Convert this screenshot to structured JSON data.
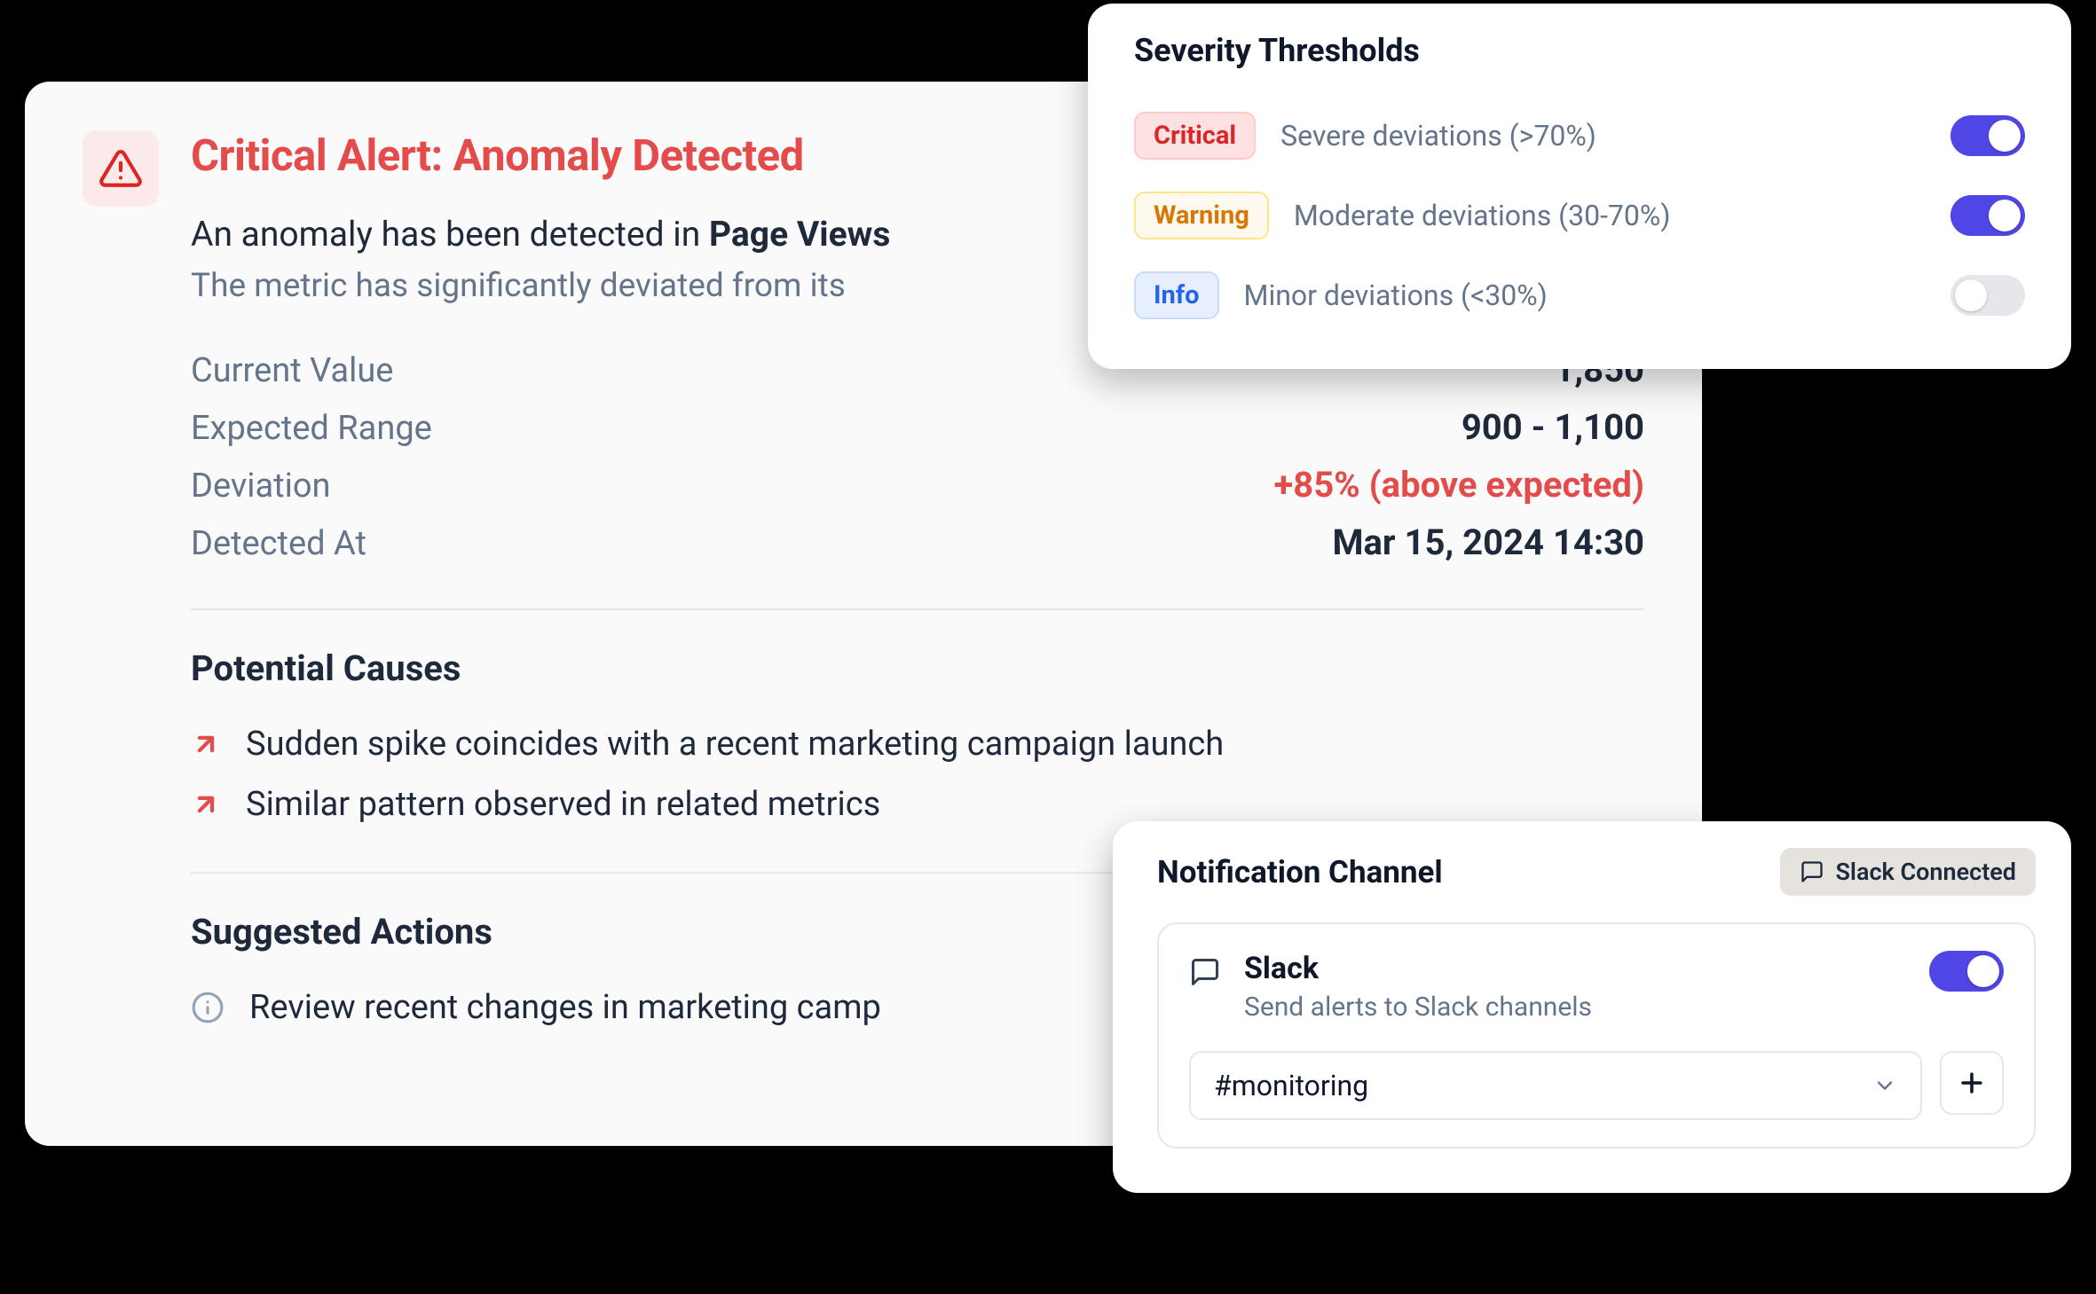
{
  "alert": {
    "title": "Critical Alert: Anomaly Detected",
    "description_prefix": "An anomaly has been detected in ",
    "metric_name": "Page Views",
    "sub": "The metric has significantly deviated from its",
    "kv": {
      "current_label": "Current Value",
      "current_value": "1,850",
      "expected_label": "Expected Range",
      "expected_value": "900 - 1,100",
      "deviation_label": "Deviation",
      "deviation_value": "+85% (above expected)",
      "detected_label": "Detected At",
      "detected_value": "Mar 15, 2024 14:30"
    },
    "causes_title": "Potential Causes",
    "causes": [
      "Sudden spike coincides with a recent marketing campaign launch",
      "Similar pattern observed in related metrics"
    ],
    "actions_title": "Suggested Actions",
    "actions": [
      "Review recent changes in marketing camp"
    ]
  },
  "severity": {
    "title": "Severity Thresholds",
    "rows": [
      {
        "badge": "Critical",
        "desc": "Severe deviations (>70%)",
        "on": true
      },
      {
        "badge": "Warning",
        "desc": "Moderate deviations (30-70%)",
        "on": true
      },
      {
        "badge": "Info",
        "desc": "Minor deviations (<30%)",
        "on": false
      }
    ]
  },
  "notif": {
    "title": "Notification Channel",
    "badge": "Slack Connected",
    "service": "Slack",
    "service_desc": "Send alerts to Slack channels",
    "service_on": true,
    "channel_selected": "#monitoring"
  }
}
